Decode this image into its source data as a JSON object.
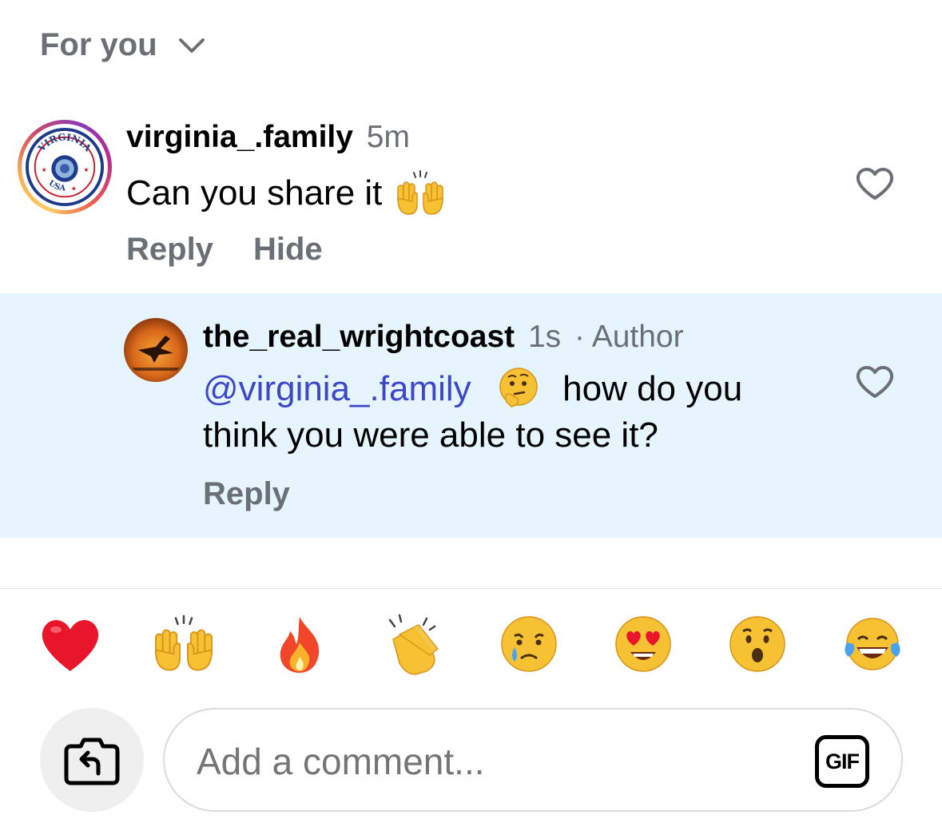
{
  "header": {
    "filter_label": "For you"
  },
  "comments": [
    {
      "username": "virginia_.family",
      "time": "5m",
      "text": "Can you share it",
      "emoji": "raising-hands",
      "actions": [
        "Reply",
        "Hide"
      ],
      "avatar_text_top": "VIRGINIA",
      "avatar_text_bottom": "USA"
    }
  ],
  "reply": {
    "username": "the_real_wrightcoast",
    "time": "1s",
    "badge": "· Author",
    "mention": "@virginia_.family",
    "emoji": "thinking-face",
    "text_after_emoji": "how do you",
    "text_line2": "think you were able to see it?",
    "action": "Reply"
  },
  "emoji_bar": [
    "red-heart",
    "raising-hands",
    "fire",
    "clapping-hands",
    "crying-face",
    "heart-eyes-face",
    "surprised-face",
    "tears-of-joy-face"
  ],
  "composer": {
    "placeholder": "Add a comment...",
    "gif_label": "GIF"
  },
  "colors": {
    "secondary_text": "#6b6f76",
    "mention": "#3d48c9",
    "reply_background": "#e5f4fd"
  }
}
